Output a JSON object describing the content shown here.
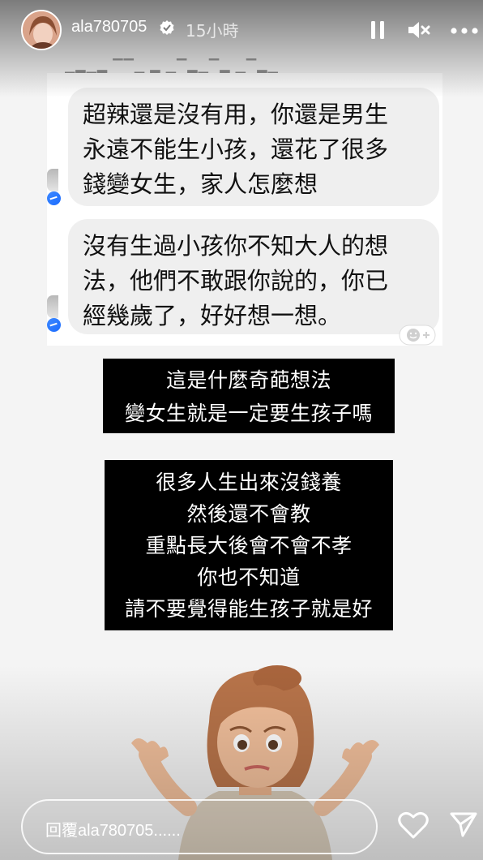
{
  "header": {
    "username": "ala780705",
    "time_ago": "15小時"
  },
  "chat": {
    "messages": [
      {
        "lines": [
          "超辣還是沒有用，你還是男生",
          "永遠不能生小孩，還花了很多",
          "錢變女生，家人怎麼想"
        ]
      },
      {
        "lines": [
          "沒有生過小孩你不知大人的想",
          "法，他們不敢跟你說的，你已",
          "經幾歲了，好好想一想。"
        ]
      }
    ]
  },
  "captions": [
    {
      "lines": [
        "這是什麼奇葩想法",
        "變女生就是一定要生孩子嗎"
      ]
    },
    {
      "lines": [
        "很多人生出來沒錢養",
        "然後還不會教",
        "重點長大後會不會不孝",
        "你也不知道",
        "請不要覺得能生孩子就是好"
      ]
    }
  ],
  "footer": {
    "reply_placeholder": "回覆ala780705......"
  },
  "icons": {
    "verified": "verified-badge-icon",
    "pause": "pause-icon",
    "mute": "speaker-muted-icon",
    "more": "more-dots-icon",
    "heart": "heart-icon",
    "send": "send-icon",
    "messenger": "messenger-icon",
    "reaction": "add-reaction-icon"
  },
  "colors": {
    "verified_blue": "#3897f0",
    "caption_bg": "#000000",
    "bubble_bg": "#efefef",
    "messenger_blue": "#2d7cff"
  }
}
